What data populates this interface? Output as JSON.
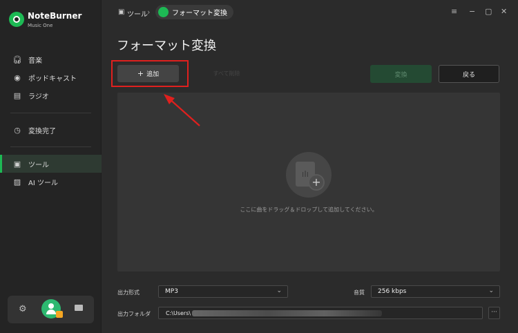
{
  "app": {
    "name": "NoteBurner",
    "subtitle": "Music One"
  },
  "sidebar": {
    "items": [
      {
        "label": "音楽",
        "icon": "headphones-icon"
      },
      {
        "label": "ポッドキャスト",
        "icon": "podcast-icon"
      },
      {
        "label": "ラジオ",
        "icon": "radio-icon"
      },
      {
        "label": "変換完了",
        "icon": "clock-icon"
      },
      {
        "label": "ツール",
        "icon": "toolbox-icon",
        "active": true
      },
      {
        "label": "AI ツール",
        "icon": "ai-icon"
      }
    ]
  },
  "breadcrumb": {
    "parent": "ツール",
    "current": "フォーマット変換"
  },
  "page": {
    "title": "フォーマット変換"
  },
  "toolbar": {
    "add_label": "追加",
    "delete_label": "すべて削除",
    "convert_label": "変換",
    "back_label": "戻る"
  },
  "dropzone": {
    "hint": "ここに曲をドラッグ＆ドロップして追加してください。"
  },
  "settings": {
    "format_label": "出力形式",
    "format_value": "MP3",
    "quality_label": "音質",
    "quality_value": "256 kbps",
    "folder_label": "出力フォルダ",
    "folder_value": "C:\\Users\\",
    "more_label": "···"
  },
  "colors": {
    "accent": "#1db954",
    "highlight": "#e0201e"
  }
}
